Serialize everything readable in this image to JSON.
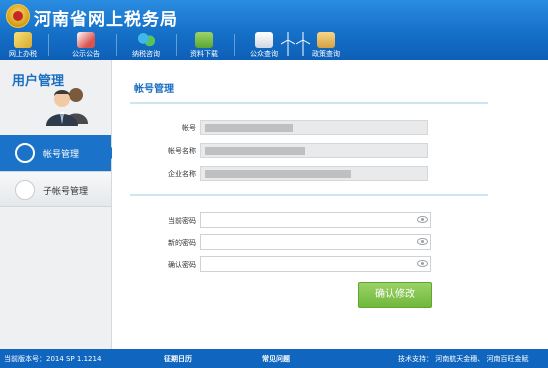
{
  "header": {
    "title": "河南省网上税务局",
    "nav": [
      {
        "label": "网上办税",
        "icon": "pen-icon"
      },
      {
        "label": "公示公告",
        "icon": "notice-icon"
      },
      {
        "label": "纳税咨询",
        "icon": "people-icon"
      },
      {
        "label": "资料下载",
        "icon": "download-icon"
      },
      {
        "label": "公众查询",
        "icon": "search-doc-icon"
      },
      {
        "label": "政策查询",
        "icon": "folder-icon"
      }
    ]
  },
  "sidebar": {
    "title": "用户管理",
    "items": [
      {
        "label": "帐号管理",
        "icon": "user-icon",
        "active": true
      },
      {
        "label": "子帐号管理",
        "icon": "share-icon",
        "active": false
      }
    ]
  },
  "main": {
    "section_title": "帐号管理",
    "info": {
      "account_label": "帐号",
      "account_name_label": "帐号名称",
      "company_name_label": "企业名称"
    },
    "password": {
      "current_label": "当前密码",
      "new_label": "新的密码",
      "confirm_label": "确认密码"
    },
    "confirm_button": "确认修改"
  },
  "footer": {
    "version": "当前版本号：2014 SP 1.1214",
    "link1": "征期日历",
    "link2": "常见问题",
    "support": "技术支持：  河南航天金穗、  河南百旺金赋"
  },
  "colors": {
    "header_blue": "#1570c8",
    "accent_blue": "#1a73c9",
    "button_green": "#6fb83b"
  }
}
